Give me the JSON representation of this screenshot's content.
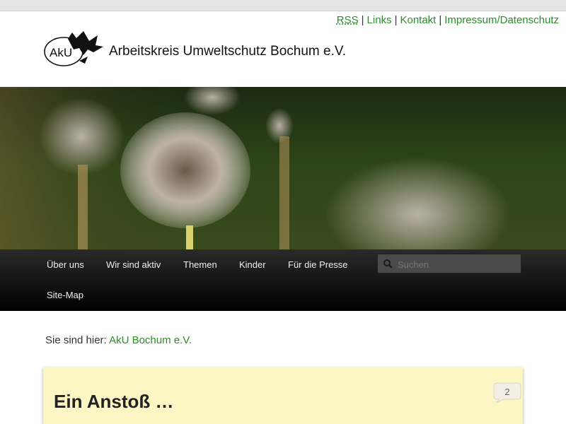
{
  "topnav": {
    "rss": "RSS",
    "links": "Links",
    "kontakt": "Kontakt",
    "impressum": "Impressum/Datenschutz",
    "separator": "|"
  },
  "logo": {
    "mark": "AkU",
    "name": "Arbeitskreis Umweltschutz Bochum e.V."
  },
  "nav": {
    "items": [
      "Über uns",
      "Wir sind aktiv",
      "Themen",
      "Kinder",
      "Für die Presse",
      "Site-Map"
    ]
  },
  "search": {
    "placeholder": "Suchen"
  },
  "breadcrumb": {
    "prefix": "Sie sind hier:",
    "link": "AkU Bochum e.V."
  },
  "post": {
    "title": "Ein Anstoß …",
    "comments": "2"
  },
  "colors": {
    "link": "#2e8b2e",
    "nav_bg": "#111111",
    "post_bg": "#fbf6c3"
  }
}
